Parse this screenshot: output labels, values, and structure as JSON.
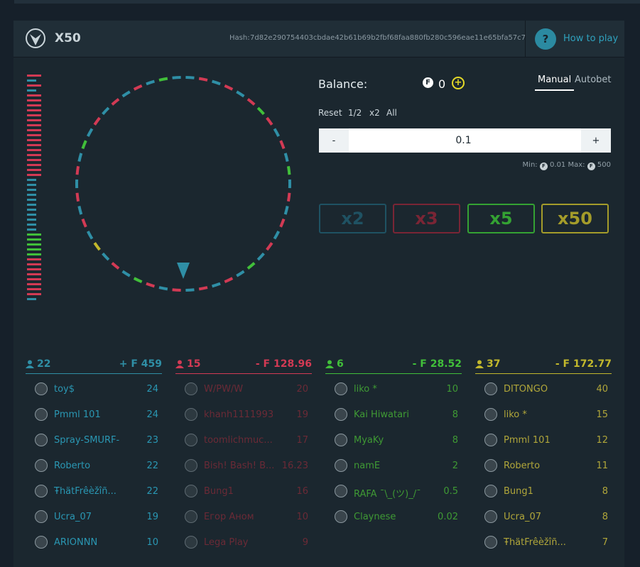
{
  "header": {
    "title": "X50",
    "hash_label": "Hash:",
    "hash_value": "7d82e290754403cbdae42b61b69b2fbf68faa880fb280c596eae11e65bfa57c7",
    "help_symbol": "?",
    "help_label": "How to play"
  },
  "balance": {
    "label": "Balance:",
    "coin_symbol": "F",
    "value": "0",
    "add_symbol": "+"
  },
  "tabs": {
    "manual": "Manual",
    "autobet": "Autobet"
  },
  "quick": {
    "reset": "Reset",
    "half": "1/2",
    "double": "x2",
    "all": "All"
  },
  "stepper": {
    "minus": "-",
    "value": "0.1",
    "plus": "+"
  },
  "limits": {
    "min_label": "Min:",
    "min_value": "0.01",
    "max_label": "Max:",
    "max_value": "500",
    "coin": "F"
  },
  "bets": {
    "x2": "x2",
    "x3": "x3",
    "x5": "x5",
    "x50": "x50"
  },
  "colors": {
    "blue": "#2f8fa6",
    "red": "#d23a54",
    "green": "#41bf3a",
    "yellow": "#c2b82c"
  },
  "columns": [
    {
      "count": "22",
      "total": "+ F 459",
      "players": [
        {
          "name": "toy$",
          "bet": "24"
        },
        {
          "name": "Pmml 101",
          "bet": "24"
        },
        {
          "name": "Spray-SMURF-",
          "bet": "23"
        },
        {
          "name": "Roberto",
          "bet": "22"
        },
        {
          "name": "ŦhätFrêèžîñ...",
          "bet": "22"
        },
        {
          "name": "Ucra_07",
          "bet": "19"
        },
        {
          "name": "ARIONNN",
          "bet": "10"
        }
      ]
    },
    {
      "count": "15",
      "total": "- F 128.96",
      "players": [
        {
          "name": "W/PW/W",
          "bet": "20"
        },
        {
          "name": "khanh1111993",
          "bet": "19"
        },
        {
          "name": "toomlichmuc...",
          "bet": "17"
        },
        {
          "name": "Bish! Bash! B...",
          "bet": "16.23"
        },
        {
          "name": "Bung1",
          "bet": "16"
        },
        {
          "name": "Егор Аном",
          "bet": "10"
        },
        {
          "name": "Lega Play",
          "bet": "9"
        }
      ]
    },
    {
      "count": "6",
      "total": "- F 28.52",
      "players": [
        {
          "name": "liko *",
          "bet": "10"
        },
        {
          "name": "Kai Hiwatari",
          "bet": "8"
        },
        {
          "name": "MyaKy",
          "bet": "8"
        },
        {
          "name": "namE",
          "bet": "2"
        },
        {
          "name": "RAFA ¯\\_(ツ)_/¯",
          "bet": "0.5"
        },
        {
          "name": "Claynese",
          "bet": "0.02"
        }
      ]
    },
    {
      "count": "37",
      "total": "- F 172.77",
      "players": [
        {
          "name": "DITONGO",
          "bet": "40"
        },
        {
          "name": "liko *",
          "bet": "15"
        },
        {
          "name": "Pmml 101",
          "bet": "12"
        },
        {
          "name": "Roberto",
          "bet": "11"
        },
        {
          "name": "Bung1",
          "bet": "8"
        },
        {
          "name": "Ucra_07",
          "bet": "8"
        },
        {
          "name": "ŦhätFrêèžîñ...",
          "bet": "7"
        }
      ]
    }
  ]
}
